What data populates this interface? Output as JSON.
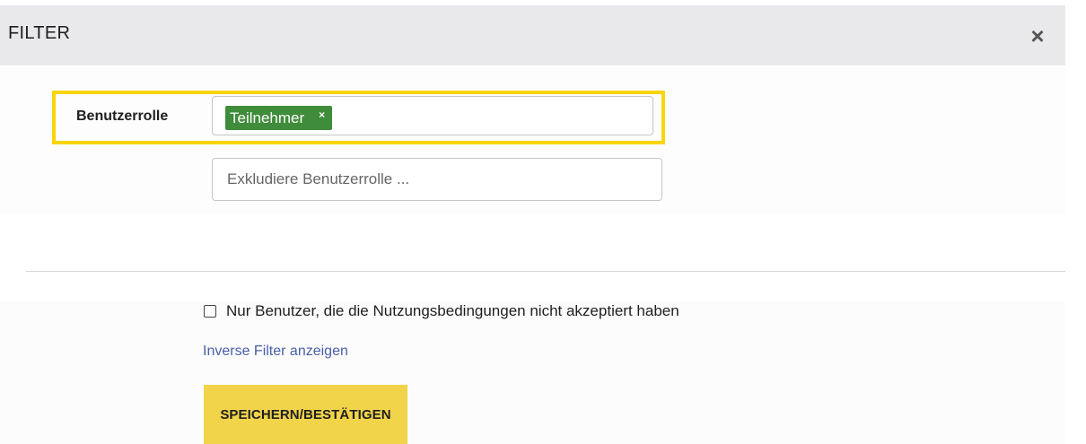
{
  "modal": {
    "title": "FILTER",
    "close_icon": "×"
  },
  "filter": {
    "role_label": "Benutzerrolle",
    "selected_roles": [
      {
        "label": "Teilnehmer",
        "remove_icon": "×"
      }
    ],
    "exclude_placeholder": "Exkludiere Benutzerrolle ..."
  },
  "options": {
    "terms_checkbox_label": "Nur Benutzer, die die Nutzungsbedingungen nicht akzeptiert haben",
    "terms_checkbox_checked": false,
    "inverse_link": "Inverse Filter anzeigen"
  },
  "actions": {
    "save_label": "SPEICHERN/BESTÄTIGEN"
  },
  "colors": {
    "highlight": "#fad40a",
    "tag_bg": "#3f8c3a",
    "button_bg": "#f2d44a",
    "link": "#4a5fa8"
  }
}
